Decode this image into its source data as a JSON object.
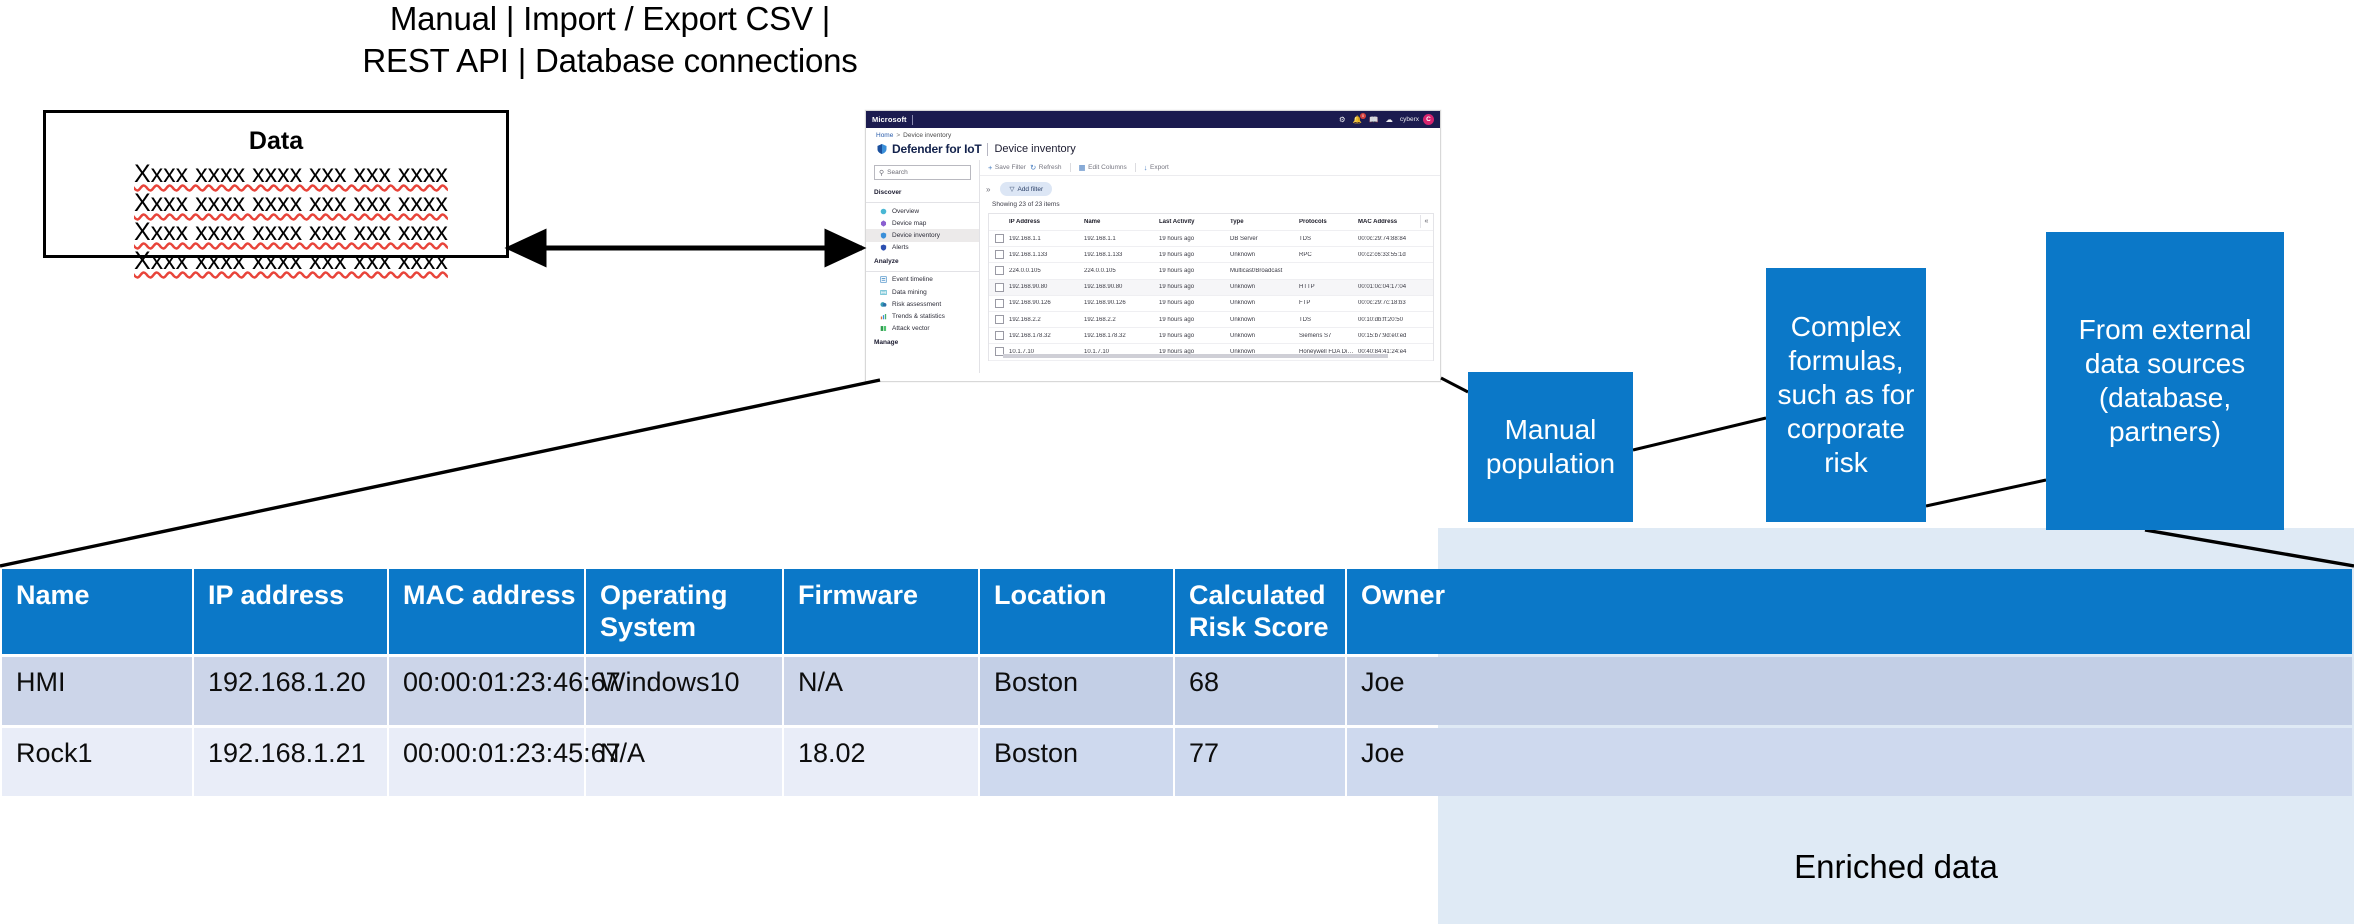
{
  "headline": "Manual | Import / Export CSV |\nREST API | Database connections",
  "data_box": {
    "title": "Data",
    "rows": [
      "Xxxx xxxx xxxx xxx xxx xxxx",
      "Xxxx xxxx xxxx xxx xxx xxxx",
      "Xxxx xxxx xxxx xxx xxx xxxx",
      "Xxxx xxxx xxxx xxx xxx xxxx"
    ]
  },
  "screenshot": {
    "topbar": {
      "brand": "Microsoft",
      "username": "cyberx",
      "avatar_initial": "C",
      "notification_badge": "0",
      "icons": [
        "gear-icon",
        "bell-icon",
        "book-icon",
        "cloud-icon"
      ]
    },
    "breadcrumb": {
      "home": "Home",
      "separator": ">",
      "current": "Device inventory"
    },
    "product": "Defender for IoT",
    "page": "Device inventory",
    "search_placeholder": "Search",
    "nav": {
      "discover_label": "Discover",
      "discover_items": [
        "Overview",
        "Device map",
        "Device inventory",
        "Alerts"
      ],
      "analyze_label": "Analyze",
      "analyze_items": [
        "Event timeline",
        "Data mining",
        "Risk assessment",
        "Trends & statistics",
        "Attack vector"
      ],
      "manage_label": "Manage",
      "selected": "Device inventory"
    },
    "toolbar": {
      "save_filter": "Save Filter",
      "refresh": "Refresh",
      "edit_columns": "Edit Columns",
      "export": "Export",
      "add_filter": "Add filter"
    },
    "showing": "Showing 23 of 23 items",
    "grid": {
      "columns": [
        "IP Address",
        "Name",
        "Last Activity",
        "Type",
        "Protocols",
        "MAC Address"
      ],
      "rows": [
        [
          "192.168.1.1",
          "192.168.1.1",
          "19 hours ago",
          "DB Server",
          "TDS",
          "00:0c:29:74:88:84"
        ],
        [
          "192.168.1.133",
          "192.168.1.133",
          "19 hours ago",
          "Unknown",
          "RPC",
          "00:c2:c6:33:55:1d"
        ],
        [
          "224.0.0.105",
          "224.0.0.105",
          "19 hours ago",
          "Multicast/Broadcast",
          "",
          ""
        ],
        [
          "192.168.90.80",
          "192.168.90.80",
          "19 hours ago",
          "Unknown",
          "HTTP",
          "00:01:0c:04:17:04"
        ],
        [
          "192.168.90.126",
          "192.168.90.126",
          "19 hours ago",
          "Unknown",
          "FTP",
          "00:0c:29:7c:18:b3"
        ],
        [
          "192.168.2.2",
          "192.168.2.2",
          "19 hours ago",
          "Unknown",
          "TDS",
          "00:10:db:ff:20:50"
        ],
        [
          "192.168.178.32",
          "192.168.178.32",
          "19 hours ago",
          "Unknown",
          "Siemens S7",
          "00:15:b7:9d:e0:ed"
        ],
        [
          "10.1.7.10",
          "10.1.7.10",
          "19 hours ago",
          "Unknown",
          "Honeywell FDA Diag...",
          "00:40:84:41:24:e4"
        ]
      ]
    }
  },
  "callouts": [
    {
      "id": "manual",
      "text": "Manual\npopulation"
    },
    {
      "id": "formulas",
      "text": "Complex\nformulas,\nsuch as for\ncorporate risk"
    },
    {
      "id": "external",
      "text": "From external\ndata sources\n(database,\npartners)"
    }
  ],
  "main_table": {
    "columns": [
      "Name",
      "IP address",
      "MAC address",
      "Operating\nSystem",
      "Firmware",
      "Location",
      "Calculated\nRisk Score",
      "Owner"
    ],
    "enriched_from_column": 5,
    "rows": [
      [
        "HMI",
        "192.168.1.20",
        "00:00:01:23:46:67",
        "Windows10",
        "N/A",
        "Boston",
        "68",
        "Joe"
      ],
      [
        "Rock1",
        "192.168.1.21",
        "00:00:01:23:45:67",
        "N/A",
        "18.02",
        "Boston",
        "77",
        "Joe"
      ]
    ]
  },
  "enriched_label": "Enriched data",
  "colors": {
    "accent_blue": "#0b78c8",
    "header_navy": "#1b1b4f",
    "row_dark": "#ccd5e9",
    "row_light": "#e9edf8",
    "enriched_band": "#dfeaf5",
    "spellcheck_red": "#e8443a",
    "avatar_pink": "#d6246e"
  }
}
